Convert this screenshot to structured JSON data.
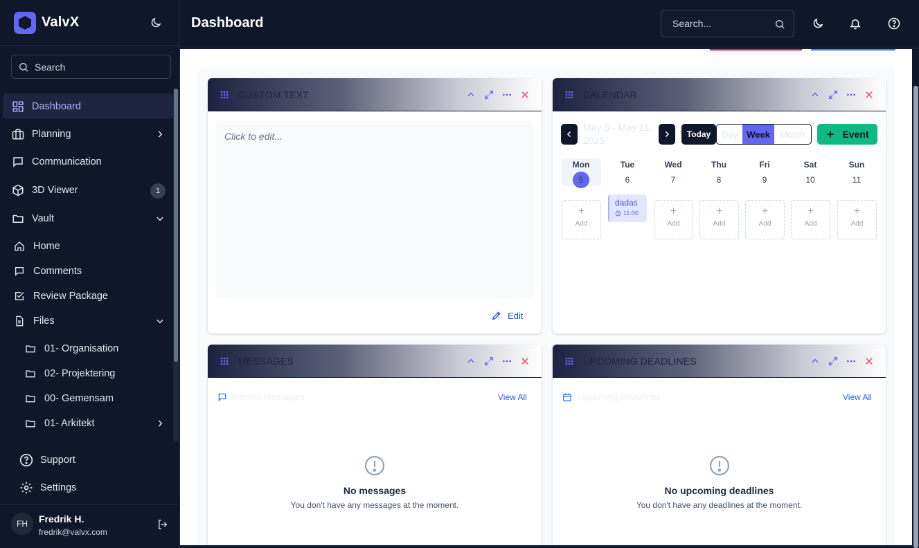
{
  "brand": {
    "name": "ValvX",
    "accent": "#6366f1"
  },
  "sidebar": {
    "search_placeholder": "Search",
    "items": [
      {
        "label": "Dashboard",
        "icon": "dashboard-icon",
        "active": true
      },
      {
        "label": "Planning",
        "icon": "briefcase-icon"
      },
      {
        "label": "Communication",
        "icon": "message-icon"
      },
      {
        "label": "3D Viewer",
        "icon": "cube-icon",
        "badge": "1"
      },
      {
        "label": "Vault",
        "icon": "folder-icon"
      },
      {
        "label": "Home",
        "icon": "home-icon"
      },
      {
        "label": "Comments",
        "icon": "comment-icon"
      },
      {
        "label": "Review Package",
        "icon": "checkbox-icon"
      },
      {
        "label": "Files",
        "icon": "file-icon"
      },
      {
        "label": "01- Organisation",
        "icon": "folder-icon"
      },
      {
        "label": "02- Projektering",
        "icon": "folder-icon"
      },
      {
        "label": "00- Gemensam",
        "icon": "folder-icon"
      },
      {
        "label": "01- Arkitekt",
        "icon": "folder-icon"
      }
    ],
    "support": "Support",
    "settings": "Settings",
    "user": {
      "initials": "FH",
      "name": "Fredrik H.",
      "email": "fredrik@valvx.com"
    }
  },
  "header": {
    "title": "Dashboard",
    "search_placeholder": "Search..."
  },
  "widgets": {
    "custom_text": {
      "title": "CUSTOM TEXT",
      "placeholder": "Click to edit...",
      "edit_label": "Edit"
    },
    "calendar": {
      "title": "CALENDAR",
      "range_line1": "May 5 - May 11,",
      "range_line2": "2025",
      "today_label": "Today",
      "views": [
        "Day",
        "Week",
        "Month"
      ],
      "active_view": "Week",
      "event_button": "Event",
      "days": [
        {
          "name": "Mon",
          "date": "5",
          "today": true
        },
        {
          "name": "Tue",
          "date": "6"
        },
        {
          "name": "Wed",
          "date": "7"
        },
        {
          "name": "Thu",
          "date": "8"
        },
        {
          "name": "Fri",
          "date": "9"
        },
        {
          "name": "Sat",
          "date": "10"
        },
        {
          "name": "Sun",
          "date": "11"
        }
      ],
      "add_label": "Add",
      "event": {
        "name": "dadas",
        "time": "11:00"
      }
    },
    "messages": {
      "title": "MESSAGES",
      "subtitle": "Recent Messages",
      "view_all": "View All",
      "empty_title": "No messages",
      "empty_text": "You don't have any messages at the moment."
    },
    "deadlines": {
      "title": "UPCOMING DEADLINES",
      "subtitle": "Upcoming Deadlines",
      "view_all": "View All",
      "empty_title": "No upcoming deadlines",
      "empty_text": "You don't have any deadlines at the moment."
    }
  }
}
